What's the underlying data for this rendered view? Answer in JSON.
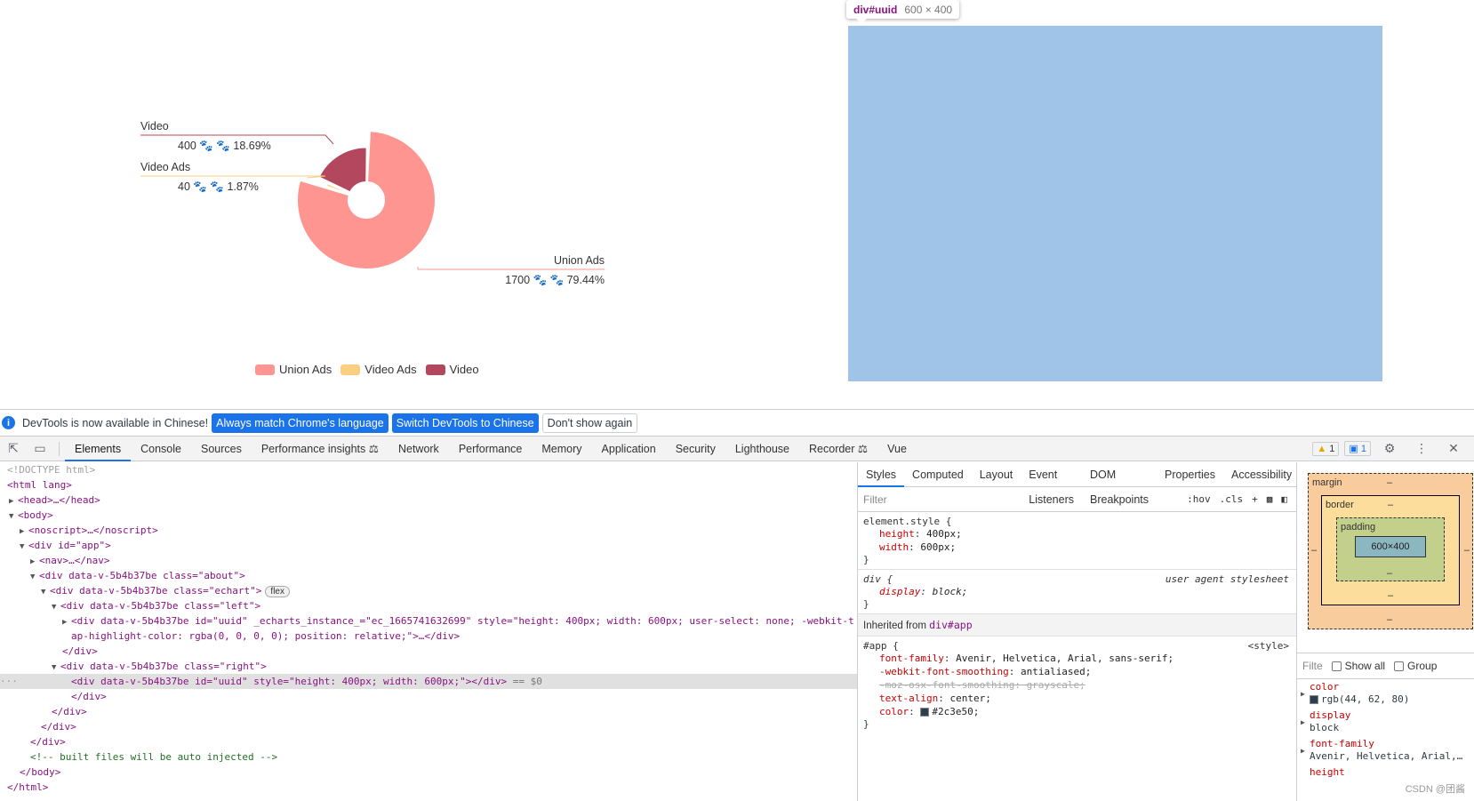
{
  "chart_data": {
    "type": "pie",
    "variant": "rose / donut",
    "slices": [
      {
        "name": "Union Ads",
        "value": 1700,
        "percent": "79.44%",
        "color": "#ff9590"
      },
      {
        "name": "Video Ads",
        "value": 40,
        "percent": "1.87%",
        "color": "#fbcf80"
      },
      {
        "name": "Video",
        "value": 400,
        "percent": "18.69%",
        "color": "#b3475d"
      }
    ],
    "legend": {
      "position": "bottom",
      "items": [
        "Union Ads",
        "Video Ads",
        "Video"
      ]
    }
  },
  "labels": [
    {
      "name": "Video",
      "value": "400",
      "percent": "18.69%"
    },
    {
      "name": "Video Ads",
      "value": "40",
      "percent": "1.87%"
    },
    {
      "name": "Union Ads",
      "value": "1700",
      "percent": "79.44%"
    }
  ],
  "tooltip": {
    "selector": "div#uuid",
    "dims": "600 × 400"
  },
  "infobar": {
    "message": "DevTools is now available in Chinese!",
    "btn1": "Always match Chrome's language",
    "btn2": "Switch DevTools to Chinese",
    "btn3": "Don't show again"
  },
  "tabs": [
    "Elements",
    "Console",
    "Sources",
    "Performance insights",
    "Network",
    "Performance",
    "Memory",
    "Application",
    "Security",
    "Lighthouse",
    "Recorder",
    "Vue"
  ],
  "badges": {
    "warn": "1",
    "msg": "1"
  },
  "dom": {
    "doctype": "<!DOCTYPE html>",
    "l_html": "<html lang>",
    "l_head": "<head>…</head>",
    "l_body": "<body>",
    "l_noscript": "<noscript>…</noscript>",
    "l_app": "<div id=\"app\">",
    "l_nav": "<nav>…</nav>",
    "l_about": "<div data-v-5b4b37be class=\"about\">",
    "l_echart": "<div data-v-5b4b37be class=\"echart\">",
    "flex": "flex",
    "l_left": "<div data-v-5b4b37be class=\"left\">",
    "l_uuid1a": "<div data-v-5b4b37be id=\"uuid\" _echarts_instance_=\"ec_1665741632699\" style=\"height: 400px; width: 600px; user-select: none; -webkit-t",
    "l_uuid1b": "ap-highlight-color: rgba(0, 0, 0, 0); position: relative;\">…</div>",
    "l_close_div": "</div>",
    "l_right": "<div data-v-5b4b37be class=\"right\">",
    "l_uuid2": "<div data-v-5b4b37be id=\"uuid\" style=\"height: 400px; width: 600px;\"></div>",
    "l_dollar": "== $0",
    "l_comment": "<!-- built files will be auto injected -->",
    "l_close_body": "</body>",
    "l_close_html": "</html>"
  },
  "styles": {
    "subtabs": [
      "Styles",
      "Computed",
      "Layout",
      "Event Listeners",
      "DOM Breakpoints",
      "Properties",
      "Accessibility"
    ],
    "filter_placeholder": "Filter",
    "hov": ":hov",
    "cls": ".cls",
    "element_style": "element.style {",
    "height": "height",
    "height_val": "400px;",
    "width": "width",
    "width_val": "600px;",
    "close": "}",
    "div_sel": "div {",
    "ua": "user agent stylesheet",
    "display": "display",
    "display_val": "block;",
    "inherited_label": "Inherited from",
    "inherited_sel": "div#app",
    "app_sel": "#app {",
    "app_src": "<style>",
    "ff": "font-family",
    "ff_val": "Avenir, Helvetica, Arial, sans-serif;",
    "wfs": "-webkit-font-smoothing",
    "wfs_val": "antialiased;",
    "moz": "-moz-osx-font-smoothing: grayscale;",
    "ta": "text-align",
    "ta_val": "center;",
    "color": "color",
    "color_val": "#2c3e50;",
    "color_swatch": "#2c3e50"
  },
  "computed": {
    "margin": "margin",
    "border": "border",
    "padding": "padding",
    "content": "600×400",
    "dash": "–",
    "filter_placeholder": "Filte",
    "show_all": "Show all",
    "group": "Group",
    "props": [
      {
        "name": "color",
        "value": "rgb(44, 62, 80)"
      },
      {
        "name": "display",
        "value": "block"
      },
      {
        "name": "font-family",
        "value": "Avenir, Helvetica, Arial,…"
      },
      {
        "name": "height",
        "value": ""
      }
    ],
    "watermark": "CSDN @团酱"
  }
}
